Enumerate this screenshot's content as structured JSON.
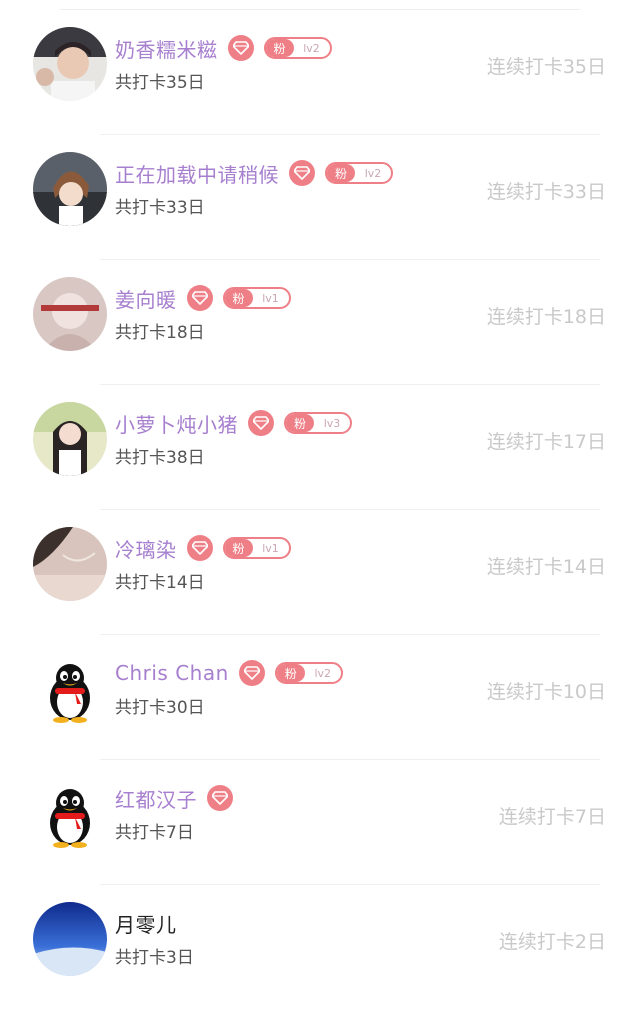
{
  "colors": {
    "name_purple": "#a77fcf",
    "badge_pink": "#ef7f86",
    "streak_gray": "#c9c9c9",
    "name_plain": "#222222"
  },
  "icons": {
    "gem": "diamond-icon",
    "qq": "penguin-icon"
  },
  "rows": [
    {
      "name": "奶香糯米糍",
      "badge_fan": "粉",
      "badge_level": "lv2",
      "total": "共打卡35日",
      "streak": "连续打卡35日"
    },
    {
      "name": "正在加载中请稍候",
      "badge_fan": "粉",
      "badge_level": "lv2",
      "total": "共打卡33日",
      "streak": "连续打卡33日"
    },
    {
      "name": "姜向暖",
      "badge_fan": "粉",
      "badge_level": "lv1",
      "total": "共打卡18日",
      "streak": "连续打卡18日"
    },
    {
      "name": "小萝卜炖小猪",
      "badge_fan": "粉",
      "badge_level": "lv3",
      "total": "共打卡38日",
      "streak": "连续打卡17日"
    },
    {
      "name": "冷璃染",
      "badge_fan": "粉",
      "badge_level": "lv1",
      "total": "共打卡14日",
      "streak": "连续打卡14日"
    },
    {
      "name": "Chris Chan",
      "badge_fan": "粉",
      "badge_level": "lv2",
      "total": "共打卡30日",
      "streak": "连续打卡10日"
    },
    {
      "name": "红都汉子",
      "total": "共打卡7日",
      "streak": "连续打卡7日"
    },
    {
      "name": "月零儿",
      "total": "共打卡3日",
      "streak": "连续打卡2日"
    }
  ]
}
